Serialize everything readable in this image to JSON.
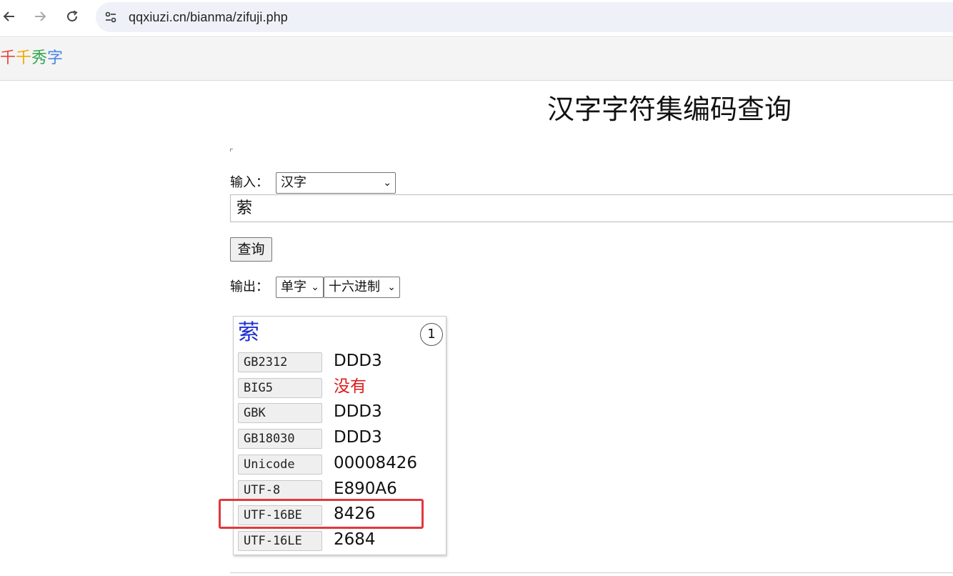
{
  "browser": {
    "url": "qqxiuzi.cn/bianma/zifuji.php",
    "back_icon": "arrow-left-icon",
    "forward_icon": "arrow-right-icon",
    "reload_icon": "reload-icon",
    "site_info_icon": "tune-icon"
  },
  "site": {
    "logo_chars": [
      "千",
      "千",
      "秀",
      "字"
    ],
    "logo_colors": [
      "#e8453c",
      "#f2a900",
      "#2fa84f",
      "#4a86e8"
    ]
  },
  "page": {
    "title": "汉字字符集编码查询",
    "input_label": "输入：",
    "input_type_selected": "汉字",
    "input_value": "萦",
    "query_button": "查询",
    "output_label": "输出：",
    "output_mode_selected": "单字",
    "output_base_selected": "十六进制"
  },
  "result": {
    "char": "萦",
    "index": "1",
    "rows": [
      {
        "label": "GB2312",
        "value": "DDD3",
        "missing": false
      },
      {
        "label": "BIG5",
        "value": "没有",
        "missing": true
      },
      {
        "label": "GBK",
        "value": "DDD3",
        "missing": false
      },
      {
        "label": "GB18030",
        "value": "DDD3",
        "missing": false
      },
      {
        "label": "Unicode",
        "value": "00008426",
        "missing": false
      },
      {
        "label": "UTF-8",
        "value": "E890A6",
        "missing": false
      },
      {
        "label": "UTF-16BE",
        "value": "8426",
        "missing": false
      },
      {
        "label": "UTF-16LE",
        "value": "2684",
        "missing": false
      }
    ],
    "highlighted_row": "UTF-16BE",
    "char_color": "#1f2fd0",
    "missing_color": "#e01b1b",
    "highlight_color": "#e0383e"
  }
}
